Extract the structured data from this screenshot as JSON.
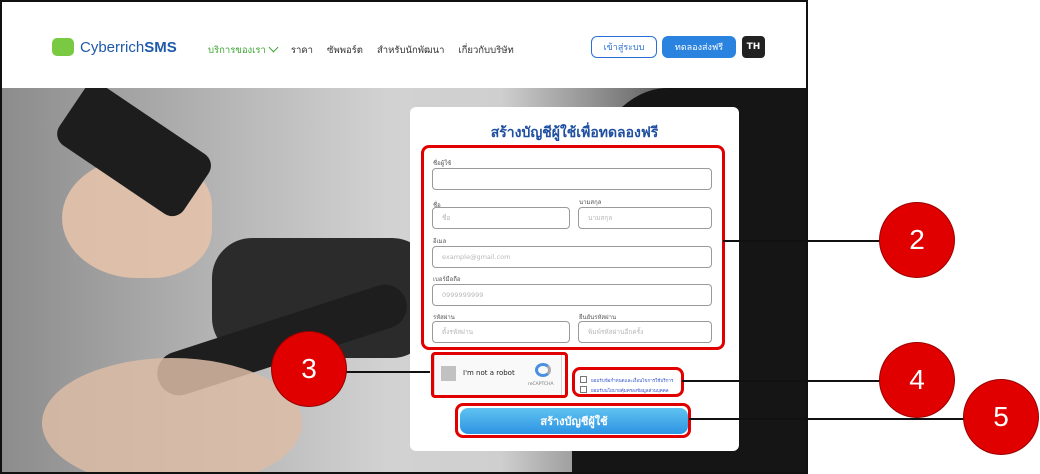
{
  "header": {
    "logo_prefix": "Cyberrich",
    "logo_suffix": "SMS",
    "nav": [
      "บริการของเรา",
      "ราคา",
      "ซัพพอร์ต",
      "สำหรับนักพัฒนา",
      "เกี่ยวกับบริษัท"
    ],
    "login_label": "เข้าสู่ระบบ",
    "try_label": "ทดลองส่งฟรี",
    "lang_label": "TH"
  },
  "form": {
    "title": "สร้างบัญชีผู้ใช้เพื่อทดลองฟรี",
    "username_label": "ชื่อผู้ใช้",
    "first_name_label": "ชื่อ",
    "first_name_placeholder": "ชื่อ",
    "last_name_label": "นามสกุล",
    "last_name_placeholder": "นามสกุล",
    "email_label": "อีเมล",
    "email_placeholder": "example@gmail.com",
    "phone_label": "เบอร์มือถือ",
    "phone_placeholder": "0999999999",
    "password_label": "รหัสผ่าน",
    "password_placeholder": "ตั้งรหัสผ่าน",
    "confirm_label": "ยืนยันรหัสผ่าน",
    "confirm_placeholder": "พิมพ์รหัสผ่านอีกครั้ง",
    "recaptcha_text": "I'm not a robot",
    "recaptcha_brand": "reCAPTCHA",
    "consent_1": "ยอมรับข้อกำหนดและเงื่อนไขการใช้บริการ",
    "consent_2": "ยอมรับนโยบายคุ้มครองข้อมูลส่วนบุคคล",
    "submit_label": "สร้างบัญชีผู้ใช้"
  },
  "callouts": [
    "2",
    "3",
    "4",
    "5"
  ],
  "colors": {
    "highlight": "#e00000",
    "callout": "#e10000",
    "primary": "#2b83e0",
    "brand_green": "#7ac943"
  }
}
